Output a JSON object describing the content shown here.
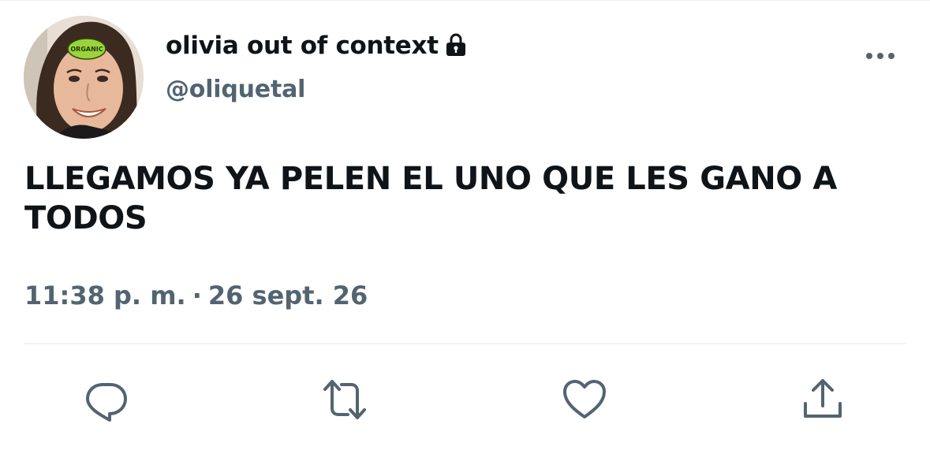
{
  "tweet": {
    "display_name": "olivia out of context",
    "handle": "@oliquetal",
    "text": "LLEGAMOS YA PELEN EL UNO QUE LES GANO A TODOS",
    "time": "11:38 p. m.",
    "separator": "·",
    "date": "26 sept. 26",
    "avatar_sticker_text": "ORGANIC"
  },
  "icons": {
    "lock": "lock-icon",
    "more": "more-icon",
    "reply": "reply-icon",
    "retweet": "retweet-icon",
    "like": "heart-icon",
    "share": "share-icon"
  },
  "colors": {
    "text_primary": "#0f1419",
    "text_secondary": "#536471",
    "divider": "#eff3f4"
  }
}
